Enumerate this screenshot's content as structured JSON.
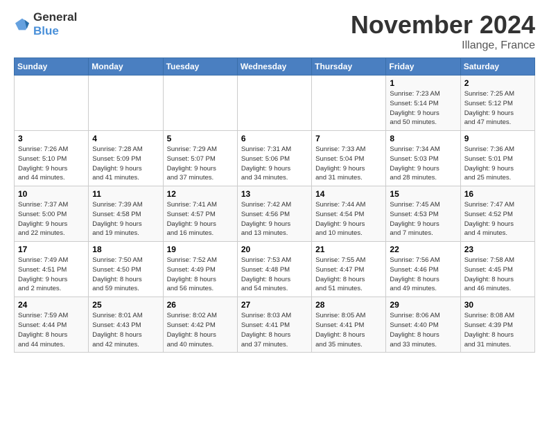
{
  "header": {
    "logo_general": "General",
    "logo_blue": "Blue",
    "month_year": "November 2024",
    "location": "Illange, France"
  },
  "columns": [
    "Sunday",
    "Monday",
    "Tuesday",
    "Wednesday",
    "Thursday",
    "Friday",
    "Saturday"
  ],
  "weeks": [
    [
      {
        "day": "",
        "info": ""
      },
      {
        "day": "",
        "info": ""
      },
      {
        "day": "",
        "info": ""
      },
      {
        "day": "",
        "info": ""
      },
      {
        "day": "",
        "info": ""
      },
      {
        "day": "1",
        "info": "Sunrise: 7:23 AM\nSunset: 5:14 PM\nDaylight: 9 hours\nand 50 minutes."
      },
      {
        "day": "2",
        "info": "Sunrise: 7:25 AM\nSunset: 5:12 PM\nDaylight: 9 hours\nand 47 minutes."
      }
    ],
    [
      {
        "day": "3",
        "info": "Sunrise: 7:26 AM\nSunset: 5:10 PM\nDaylight: 9 hours\nand 44 minutes."
      },
      {
        "day": "4",
        "info": "Sunrise: 7:28 AM\nSunset: 5:09 PM\nDaylight: 9 hours\nand 41 minutes."
      },
      {
        "day": "5",
        "info": "Sunrise: 7:29 AM\nSunset: 5:07 PM\nDaylight: 9 hours\nand 37 minutes."
      },
      {
        "day": "6",
        "info": "Sunrise: 7:31 AM\nSunset: 5:06 PM\nDaylight: 9 hours\nand 34 minutes."
      },
      {
        "day": "7",
        "info": "Sunrise: 7:33 AM\nSunset: 5:04 PM\nDaylight: 9 hours\nand 31 minutes."
      },
      {
        "day": "8",
        "info": "Sunrise: 7:34 AM\nSunset: 5:03 PM\nDaylight: 9 hours\nand 28 minutes."
      },
      {
        "day": "9",
        "info": "Sunrise: 7:36 AM\nSunset: 5:01 PM\nDaylight: 9 hours\nand 25 minutes."
      }
    ],
    [
      {
        "day": "10",
        "info": "Sunrise: 7:37 AM\nSunset: 5:00 PM\nDaylight: 9 hours\nand 22 minutes."
      },
      {
        "day": "11",
        "info": "Sunrise: 7:39 AM\nSunset: 4:58 PM\nDaylight: 9 hours\nand 19 minutes."
      },
      {
        "day": "12",
        "info": "Sunrise: 7:41 AM\nSunset: 4:57 PM\nDaylight: 9 hours\nand 16 minutes."
      },
      {
        "day": "13",
        "info": "Sunrise: 7:42 AM\nSunset: 4:56 PM\nDaylight: 9 hours\nand 13 minutes."
      },
      {
        "day": "14",
        "info": "Sunrise: 7:44 AM\nSunset: 4:54 PM\nDaylight: 9 hours\nand 10 minutes."
      },
      {
        "day": "15",
        "info": "Sunrise: 7:45 AM\nSunset: 4:53 PM\nDaylight: 9 hours\nand 7 minutes."
      },
      {
        "day": "16",
        "info": "Sunrise: 7:47 AM\nSunset: 4:52 PM\nDaylight: 9 hours\nand 4 minutes."
      }
    ],
    [
      {
        "day": "17",
        "info": "Sunrise: 7:49 AM\nSunset: 4:51 PM\nDaylight: 9 hours\nand 2 minutes."
      },
      {
        "day": "18",
        "info": "Sunrise: 7:50 AM\nSunset: 4:50 PM\nDaylight: 8 hours\nand 59 minutes."
      },
      {
        "day": "19",
        "info": "Sunrise: 7:52 AM\nSunset: 4:49 PM\nDaylight: 8 hours\nand 56 minutes."
      },
      {
        "day": "20",
        "info": "Sunrise: 7:53 AM\nSunset: 4:48 PM\nDaylight: 8 hours\nand 54 minutes."
      },
      {
        "day": "21",
        "info": "Sunrise: 7:55 AM\nSunset: 4:47 PM\nDaylight: 8 hours\nand 51 minutes."
      },
      {
        "day": "22",
        "info": "Sunrise: 7:56 AM\nSunset: 4:46 PM\nDaylight: 8 hours\nand 49 minutes."
      },
      {
        "day": "23",
        "info": "Sunrise: 7:58 AM\nSunset: 4:45 PM\nDaylight: 8 hours\nand 46 minutes."
      }
    ],
    [
      {
        "day": "24",
        "info": "Sunrise: 7:59 AM\nSunset: 4:44 PM\nDaylight: 8 hours\nand 44 minutes."
      },
      {
        "day": "25",
        "info": "Sunrise: 8:01 AM\nSunset: 4:43 PM\nDaylight: 8 hours\nand 42 minutes."
      },
      {
        "day": "26",
        "info": "Sunrise: 8:02 AM\nSunset: 4:42 PM\nDaylight: 8 hours\nand 40 minutes."
      },
      {
        "day": "27",
        "info": "Sunrise: 8:03 AM\nSunset: 4:41 PM\nDaylight: 8 hours\nand 37 minutes."
      },
      {
        "day": "28",
        "info": "Sunrise: 8:05 AM\nSunset: 4:41 PM\nDaylight: 8 hours\nand 35 minutes."
      },
      {
        "day": "29",
        "info": "Sunrise: 8:06 AM\nSunset: 4:40 PM\nDaylight: 8 hours\nand 33 minutes."
      },
      {
        "day": "30",
        "info": "Sunrise: 8:08 AM\nSunset: 4:39 PM\nDaylight: 8 hours\nand 31 minutes."
      }
    ]
  ]
}
